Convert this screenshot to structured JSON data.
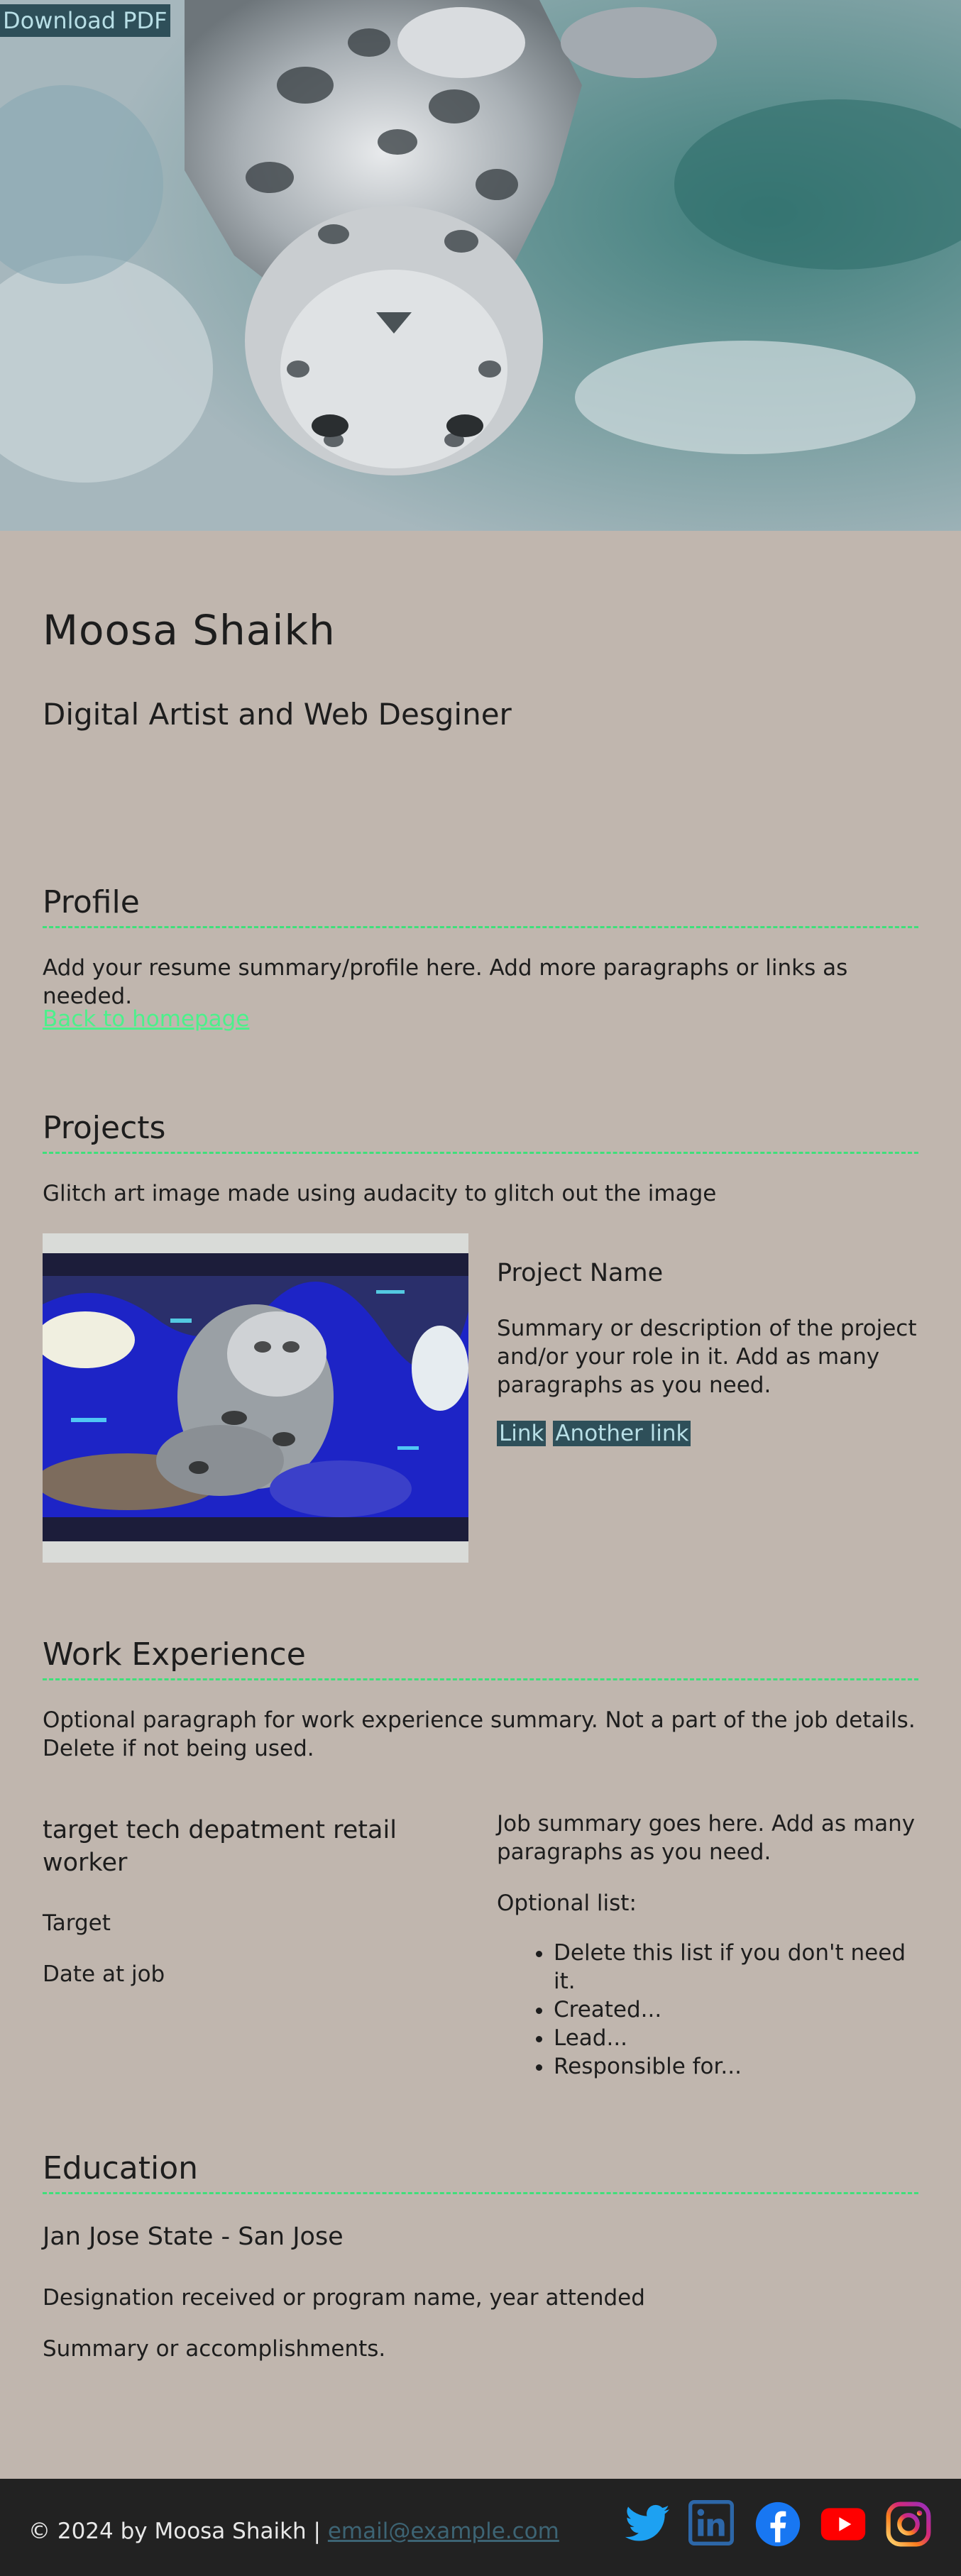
{
  "header": {
    "download_label": "Download PDF"
  },
  "person": {
    "name": "Moosa Shaikh",
    "tagline": "Digital Artist and Web Desginer"
  },
  "profile": {
    "title": "Profile",
    "summary": "Add your resume summary/profile here. Add more paragraphs or links as needed.",
    "back_link": "Back to homepage"
  },
  "projects": {
    "title": "Projects",
    "intro": "Glitch art image made using audacity to glitch out the image",
    "item": {
      "name": "Project Name",
      "description": "Summary or description of the project and/or your role in it. Add as many paragraphs as you need.",
      "links": [
        "Link",
        "Another link"
      ]
    }
  },
  "work": {
    "title": "Work Experience",
    "intro": "Optional paragraph for work experience summary. Not a part of the job details. Delete if not being used.",
    "job": {
      "title": "target tech depatment retail worker",
      "company": "Target",
      "date": "Date at job",
      "summary": "Job summary goes here. Add as many paragraphs as you need.",
      "list_label": "Optional list:",
      "list": [
        "Delete this list if you don't need it.",
        "Created...",
        "Lead...",
        "Responsible for..."
      ]
    }
  },
  "education": {
    "title": "Education",
    "school": "Jan Jose State - San Jose",
    "designation": "Designation received or program name, year attended",
    "summary": "Summary or accomplishments."
  },
  "footer": {
    "copyright": "© 2024 by Moosa Shaikh |",
    "email": "email@example.com",
    "social": [
      "twitter-icon",
      "linkedin-icon",
      "facebook-icon",
      "youtube-icon",
      "instagram-icon"
    ]
  },
  "colors": {
    "background": "#c0b6ae",
    "accent_green": "#3ee07a",
    "dark_button": "#2e4f59",
    "footer": "#222222"
  }
}
